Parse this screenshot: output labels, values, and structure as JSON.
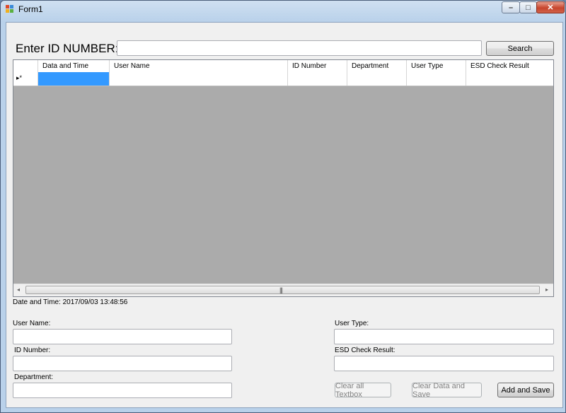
{
  "window": {
    "title": "Form1",
    "min_symbol": "–",
    "max_symbol": "□",
    "close_symbol": "✕"
  },
  "search": {
    "label": "Enter ID NUMBER:",
    "value": "",
    "button_label": "Search"
  },
  "grid": {
    "columns": [
      "Data and Time",
      "User Name",
      "ID Number",
      "Department",
      "User Type",
      "ESD Check Result"
    ],
    "new_row_marker": "▸*",
    "scroll_grip": "|||",
    "left_arrow": "◂",
    "right_arrow": "▸"
  },
  "datetime_line": "Date and Time: 2017/09/03 13:48:56",
  "form": {
    "user_name_label": "User Name:",
    "id_number_label": "ID Number:",
    "department_label": "Department:",
    "user_type_label": "User Type:",
    "esd_label": "ESD Check Result:",
    "user_name": "",
    "id_number": "",
    "department": "",
    "user_type": "",
    "esd_result": ""
  },
  "buttons": {
    "clear_textbox": "Clear all Textbox",
    "clear_save": "Clear Data and Save",
    "add_save": "Add and Save"
  },
  "colors": {
    "selection": "#3399ff",
    "grid_bg": "#ababab"
  }
}
